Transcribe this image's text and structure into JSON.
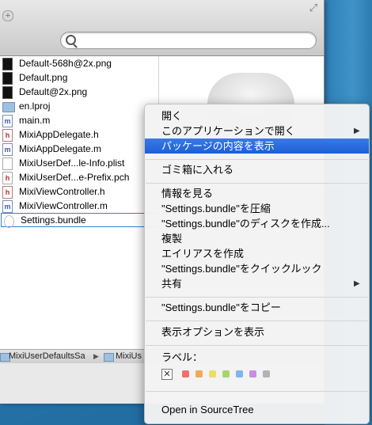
{
  "window": {
    "plus_label": "+",
    "resize_glyph": "⤢"
  },
  "search": {
    "value": ""
  },
  "files": [
    {
      "name": "Default-568h@2x.png",
      "icon": "png-icon"
    },
    {
      "name": "Default.png",
      "icon": "png-icon"
    },
    {
      "name": "Default@2x.png",
      "icon": "png-icon"
    },
    {
      "name": "en.lproj",
      "icon": "folder-icon"
    },
    {
      "name": "main.m",
      "icon": "m-file-icon",
      "glyph": "m"
    },
    {
      "name": "MixiAppDelegate.h",
      "icon": "h-file-icon",
      "glyph": "h"
    },
    {
      "name": "MixiAppDelegate.m",
      "icon": "m-file-icon",
      "glyph": "m"
    },
    {
      "name": "MixiUserDef...le-Info.plist",
      "icon": "plist-file-icon",
      "glyph": ""
    },
    {
      "name": "MixiUserDef...e-Prefix.pch",
      "icon": "pch-file-icon",
      "glyph": "h"
    },
    {
      "name": "MixiViewController.h",
      "icon": "h-file-icon",
      "glyph": "h"
    },
    {
      "name": "MixiViewController.m",
      "icon": "m-file-icon",
      "glyph": "m"
    },
    {
      "name": "Settings.bundle",
      "icon": "bundle-icon",
      "glyph": "",
      "selected": true
    }
  ],
  "pathbar": {
    "items": [
      "MixiUserDefaultsSa",
      "MixiUs"
    ]
  },
  "menu": {
    "open": "開く",
    "open_with": "このアプリケーションで開く",
    "show_package_contents": "パッケージの内容を表示",
    "move_to_trash": "ゴミ箱に入れる",
    "get_info": "情報を見る",
    "compress": "\"Settings.bundle\"を圧縮",
    "burn": "\"Settings.bundle\"のディスクを作成...",
    "duplicate": "複製",
    "make_alias": "エイリアスを作成",
    "quick_look": "\"Settings.bundle\"をクイックルック",
    "share": "共有",
    "copy": "\"Settings.bundle\"をコピー",
    "view_options": "表示オプションを表示",
    "label_heading": "ラベル：",
    "label_none_glyph": "✕",
    "label_colors": [
      "#f07070",
      "#f0a860",
      "#eedc6a",
      "#a6d66a",
      "#80b4ee",
      "#c88ee0",
      "#b3b3b3"
    ],
    "open_in_sourcetree": "Open in SourceTree",
    "submenu_arrow": "▶"
  }
}
